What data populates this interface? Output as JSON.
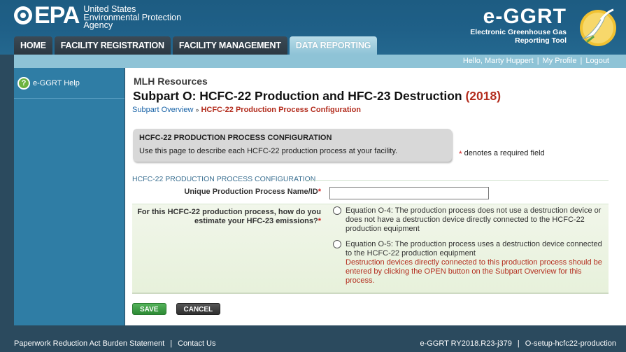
{
  "agency": {
    "abbr": "EPA",
    "line1": "United States",
    "line2": "Environmental Protection",
    "line3": "Agency"
  },
  "tool": {
    "title": "e-GGRT",
    "sub1": "Electronic Greenhouse Gas",
    "sub2": "Reporting Tool"
  },
  "nav": {
    "home": "HOME",
    "facility_registration": "FACILITY REGISTRATION",
    "facility_management": "FACILITY MANAGEMENT",
    "data_reporting": "DATA REPORTING"
  },
  "userbar": {
    "greeting": "Hello, Marty Huppert",
    "my_profile": "My Profile",
    "logout": "Logout",
    "sep": "|"
  },
  "sidebar": {
    "help_icon": "?",
    "help_label": "e-GGRT Help"
  },
  "page": {
    "org": "MLH Resources",
    "title": "Subpart O: HCFC-22 Production and HFC-23 Destruction",
    "year": "(2018)",
    "breadcrumb_link": "Subpart Overview",
    "breadcrumb_arrow": "»",
    "breadcrumb_current": "HCFC-22 Production Process Configuration"
  },
  "infobox": {
    "title": "HCFC-22 PRODUCTION PROCESS CONFIGURATION",
    "text": "Use this page to describe each HCFC-22 production process at your facility."
  },
  "required_note": {
    "star": "*",
    "text": "denotes a required field"
  },
  "form": {
    "section_title": "HCFC-22 PRODUCTION PROCESS CONFIGURATION",
    "name_label": "Unique Production Process Name/ID",
    "name_value": "",
    "star": "*",
    "estimate_label": "For this HCFC-22 production process, how do you estimate your HFC-23 emissions?",
    "options": [
      {
        "text": "Equation O-4: The production process does not use a destruction device or does not have a destruction device directly connected to the HCFC-22 production equipment",
        "warning": ""
      },
      {
        "text": "Equation O-5: The production process uses a destruction device connected to the HCFC-22 production equipment",
        "warning": "Destruction devices directly connected to this production process should be entered by clicking the OPEN button on the Subpart Overview for this process."
      }
    ]
  },
  "buttons": {
    "save": "SAVE",
    "cancel": "CANCEL"
  },
  "footer": {
    "paperwork": "Paperwork Reduction Act Burden Statement",
    "contact": "Contact Us",
    "version": "e-GGRT RY2018.R23-j379",
    "page_id": "O-setup-hcfc22-production",
    "sep": "|"
  },
  "colors": {
    "header": "#1f6088",
    "sidebar": "#2f7da5",
    "active_tab": "#8ec3d6",
    "required": "#d21c1c",
    "warning": "#b32d1e"
  }
}
